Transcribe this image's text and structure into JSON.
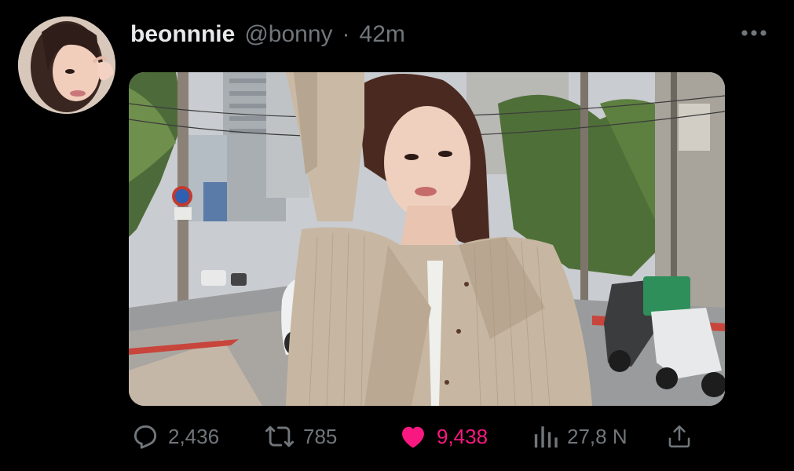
{
  "tweet": {
    "display_name": "beonnnie",
    "handle": "@bonny",
    "separator": "·",
    "timestamp": "42m",
    "more_icon": "more-dots-icon",
    "avatar": "profile-photo",
    "media": "photo-woman-street"
  },
  "actions": {
    "reply": {
      "icon": "reply-icon",
      "count": "2,436"
    },
    "retweet": {
      "icon": "retweet-icon",
      "count": "785"
    },
    "like": {
      "icon": "heart-filled-icon",
      "count": "9,438",
      "liked": true,
      "color": "#f91880"
    },
    "views": {
      "icon": "views-icon",
      "count": "27,8 N"
    },
    "share": {
      "icon": "share-icon"
    }
  },
  "colors": {
    "background": "#000000",
    "primary_text": "#e7e9ea",
    "secondary_text": "#71767b",
    "like_accent": "#f91880"
  }
}
